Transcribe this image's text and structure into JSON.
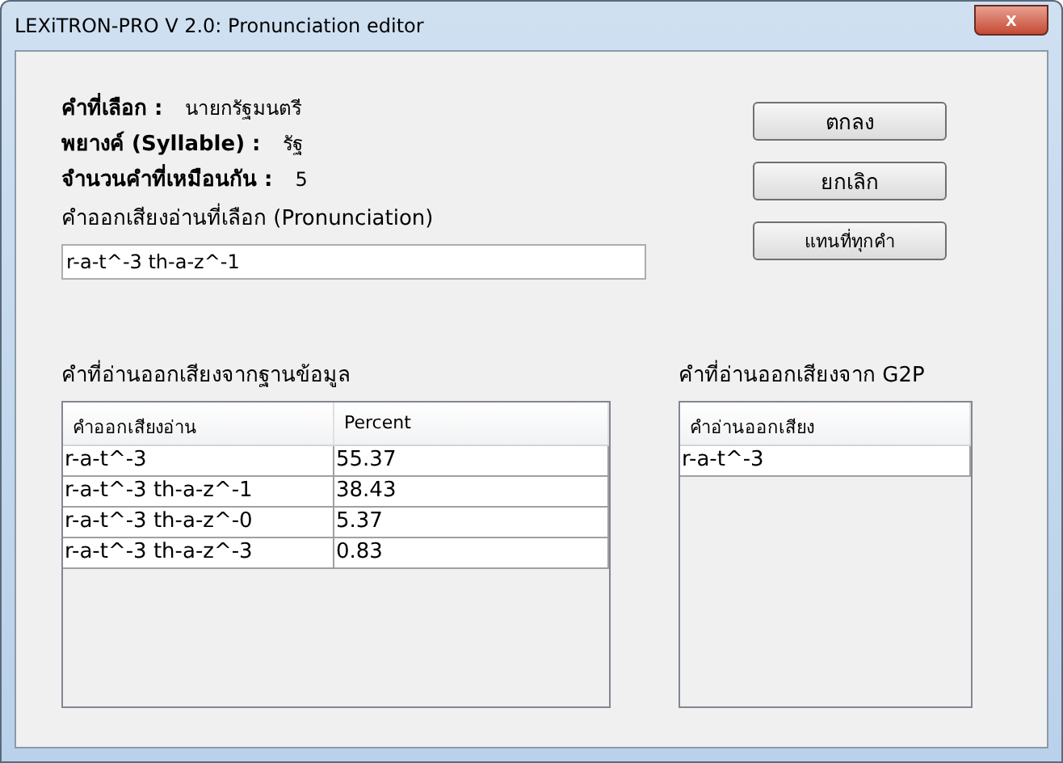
{
  "window": {
    "title": "LEXiTRON-PRO V 2.0: Pronunciation editor",
    "close": "x"
  },
  "info": [
    {
      "label": "คำที่เลือก :",
      "value": "นายกรัฐมนตรี"
    },
    {
      "label": "พยางค์ (Syllable) :",
      "value": "รัฐ"
    },
    {
      "label": "จำนวนคำที่เหมือนกัน :",
      "value": "5"
    }
  ],
  "pronunciation": {
    "label": "คำออกเสียงอ่านที่เลือก (Pronunciation)",
    "value": "r-a-t^-3 th-a-z^-1"
  },
  "buttons": [
    {
      "label": "ตกลง"
    },
    {
      "label": "ยกเลิก"
    },
    {
      "label": "แทนที่ทุกคำ"
    }
  ],
  "database_table": {
    "title": "คำที่อ่านออกเสียงจากฐานข้อมูล",
    "columns": [
      "คำออกเสียงอ่าน",
      "Percent"
    ],
    "rows": [
      [
        "r-a-t^-3",
        "55.37"
      ],
      [
        "r-a-t^-3 th-a-z^-1",
        "38.43"
      ],
      [
        "r-a-t^-3 th-a-z^-0",
        "5.37"
      ],
      [
        "r-a-t^-3 th-a-z^-3",
        "0.83"
      ]
    ]
  },
  "g2p_table": {
    "title": "คำที่อ่านออกเสียงจาก G2P",
    "columns": [
      "คำอ่านออกเสียง"
    ],
    "rows": [
      [
        "r-a-t^-3"
      ]
    ]
  }
}
